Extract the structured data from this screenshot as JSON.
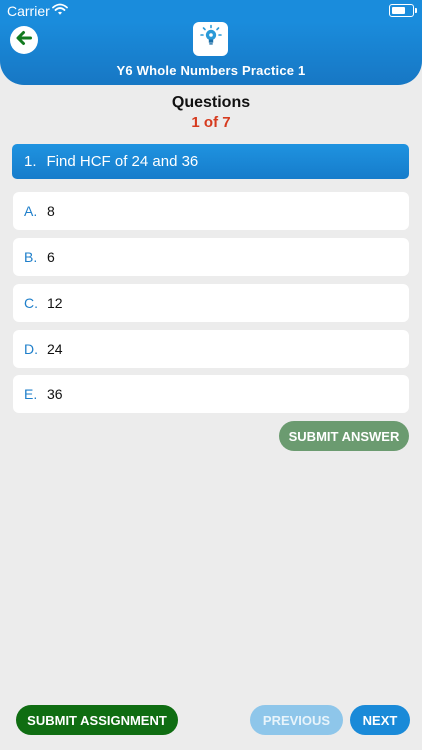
{
  "status_bar": {
    "carrier": "Carrier",
    "battery_level": 0.7
  },
  "header": {
    "title": "Y6 Whole Numbers Practice 1",
    "back_icon": "arrow-left-icon",
    "logo_icon": "lightbulb-icon"
  },
  "questions": {
    "heading": "Questions",
    "counter": "1 of 7",
    "current": {
      "number": "1.",
      "text": "Find HCF of 24 and 36"
    },
    "options": [
      {
        "letter": "A.",
        "value": "8"
      },
      {
        "letter": "B.",
        "value": "6"
      },
      {
        "letter": "C.",
        "value": "12"
      },
      {
        "letter": "D.",
        "value": "24"
      },
      {
        "letter": "E.",
        "value": "36"
      }
    ]
  },
  "buttons": {
    "submit_answer": "SUBMIT ANSWER",
    "submit_assignment": "SUBMIT ASSIGNMENT",
    "previous": "PREVIOUS",
    "next": "NEXT"
  },
  "colors": {
    "primary": "#1a8cdc",
    "counter": "#d63a1e",
    "submit_answer": "#6b9b70",
    "submit_assignment": "#0f6d12"
  }
}
